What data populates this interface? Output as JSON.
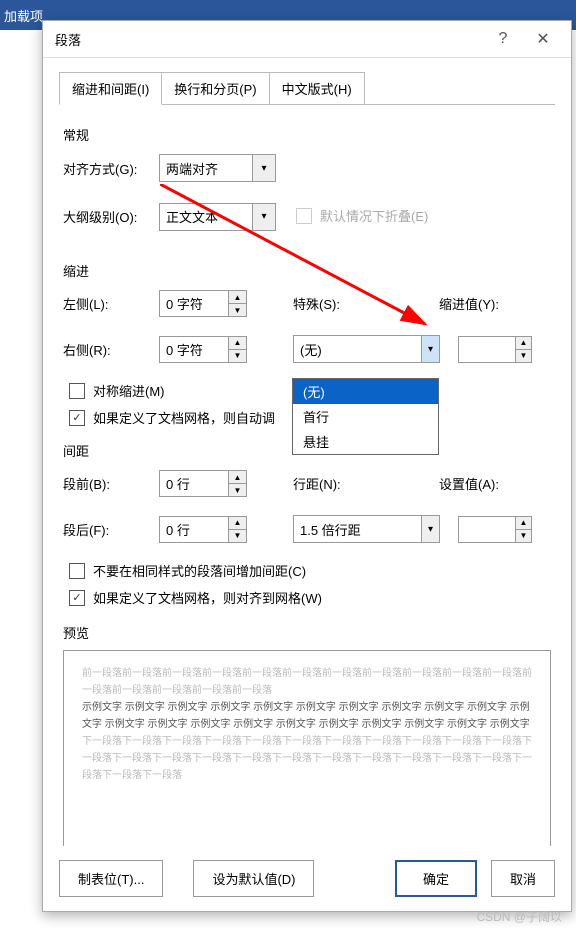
{
  "ribbon": {
    "tab": "加载项"
  },
  "dialog": {
    "title": "段落",
    "tabs": [
      "缩进和间距(I)",
      "换行和分页(P)",
      "中文版式(H)"
    ],
    "section_general": "常规",
    "align_label": "对齐方式(G):",
    "align_value": "两端对齐",
    "outline_label": "大纲级别(O):",
    "outline_value": "正文文本",
    "collapse_label": "默认情况下折叠(E)",
    "section_indent": "缩进",
    "left_label": "左侧(L):",
    "left_value": "0 字符",
    "right_label": "右侧(R):",
    "right_value": "0 字符",
    "special_label": "特殊(S):",
    "special_value": "(无)",
    "special_options": [
      "(无)",
      "首行",
      "悬挂"
    ],
    "indent_val_label": "缩进值(Y):",
    "indent_val_value": "",
    "mirror_label": "对称缩进(M)",
    "grid_indent_label": "如果定义了文档网格，则自动调",
    "section_spacing": "间距",
    "before_label": "段前(B):",
    "before_value": "0 行",
    "after_label": "段后(F):",
    "after_value": "0 行",
    "line_label": "行距(N):",
    "line_value": "1.5 倍行距",
    "setval_label": "设置值(A):",
    "setval_value": "",
    "nospace_label": "不要在相同样式的段落间增加间距(C)",
    "grid_align_label": "如果定义了文档网格，则对齐到网格(W)",
    "preview_title": "预览",
    "preview_prev": "前一段落前一段落前一段落前一段落前一段落前一段落前一段落前一段落前一段落前一段落前一段落前一段落前一段落前一段落前一段落前一段落",
    "preview_sample": "示例文字 示例文字 示例文字 示例文字 示例文字 示例文字 示例文字 示例文字 示例文字 示例文字 示例文字 示例文字 示例文字 示例文字 示例文字 示例文字 示例文字 示例文字 示例文字 示例文字 示例文字",
    "preview_next": "下一段落下一段落下一段落下一段落下一段落下一段落下一段落下一段落下一段落下一段落下一段落下一段落下一段落下一段落下一段落下一段落下一段落下一段落下一段落下一段落下一段落下一段落下一段落下一段落下一段落",
    "btn_tabs": "制表位(T)...",
    "btn_default": "设为默认值(D)",
    "btn_ok": "确定",
    "btn_cancel": "取消"
  },
  "watermark": "CSDN @子阔以"
}
